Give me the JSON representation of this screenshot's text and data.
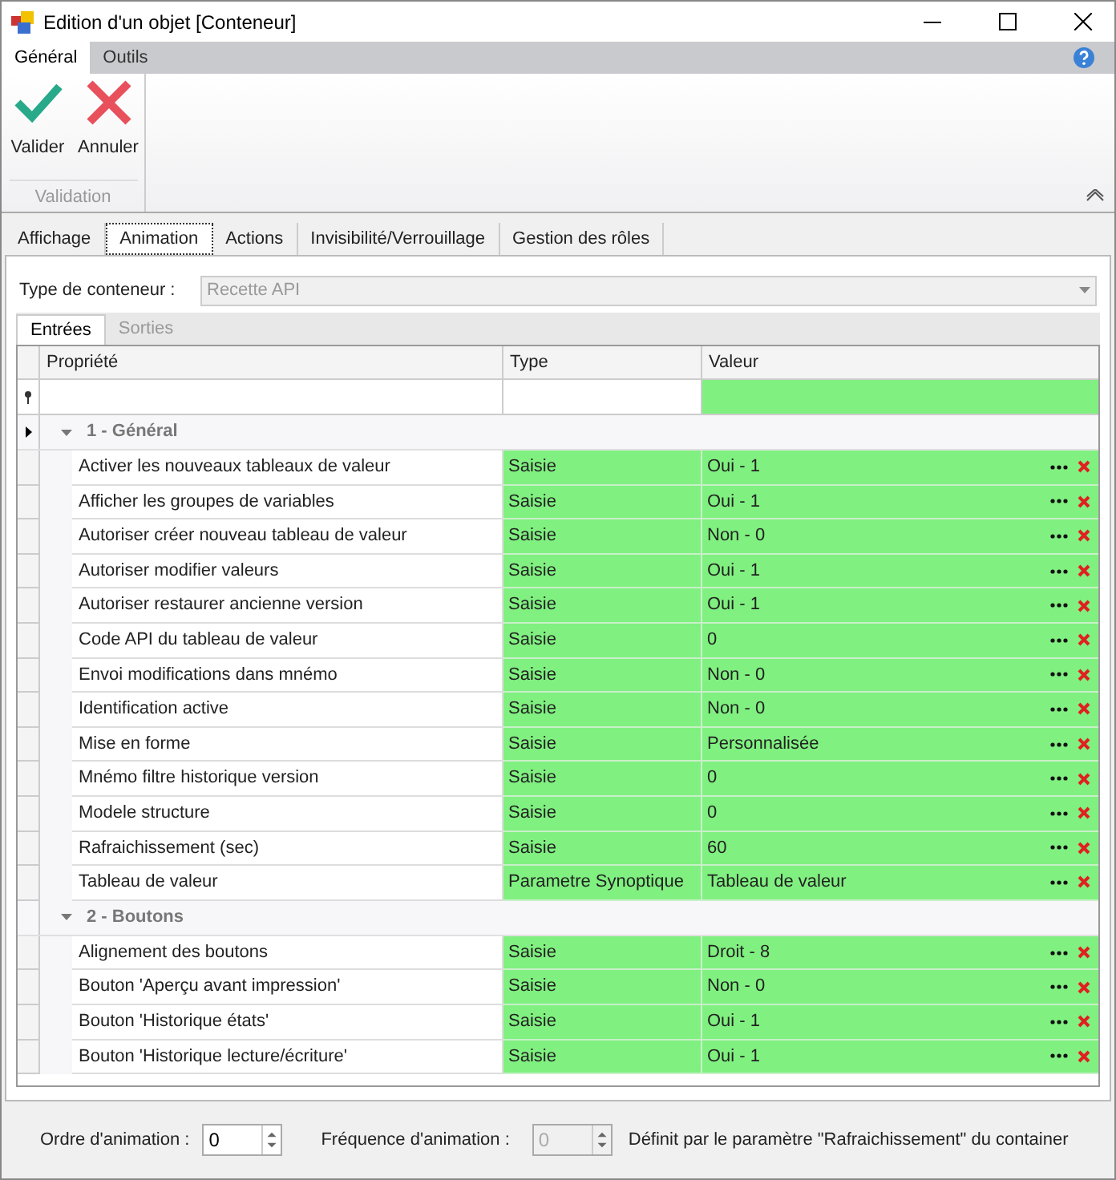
{
  "window": {
    "title": "Edition d'un objet [Conteneur]"
  },
  "ribbon_tabs": [
    {
      "label": "Général",
      "selected": true
    },
    {
      "label": "Outils",
      "selected": false
    }
  ],
  "ribbon_buttons": [
    {
      "kind": "ok",
      "label": "Valider"
    },
    {
      "kind": "cancel",
      "label": "Annuler"
    }
  ],
  "ribbon_group": "Validation",
  "tabs": [
    {
      "label": "Affichage",
      "selected": false
    },
    {
      "label": "Animation",
      "selected": true
    },
    {
      "label": "Actions",
      "selected": false
    },
    {
      "label": "Invisibilité/Verrouillage",
      "selected": false
    },
    {
      "label": "Gestion des rôles",
      "selected": false
    }
  ],
  "container_type": {
    "label": "Type de conteneur :",
    "value": "Recette API",
    "disabled": true
  },
  "sub_tabs": [
    {
      "label": "Entrées",
      "selected": true
    },
    {
      "label": "Sorties",
      "selected": false
    }
  ],
  "grid": {
    "columns": [
      "Propriété",
      "Type",
      "Valeur"
    ],
    "groups": [
      {
        "title": "1 - Général",
        "expanded": true,
        "selected": true,
        "rows": [
          {
            "property": "Activer les nouveaux tableaux de valeur",
            "type": "Saisie",
            "value": "Oui - 1"
          },
          {
            "property": "Afficher les groupes de variables",
            "type": "Saisie",
            "value": "Oui - 1"
          },
          {
            "property": "Autoriser créer nouveau tableau de valeur",
            "type": "Saisie",
            "value": "Non - 0"
          },
          {
            "property": "Autoriser modifier valeurs",
            "type": "Saisie",
            "value": "Oui - 1"
          },
          {
            "property": "Autoriser restaurer ancienne version",
            "type": "Saisie",
            "value": "Oui - 1"
          },
          {
            "property": "Code API du tableau de valeur",
            "type": "Saisie",
            "value": "0"
          },
          {
            "property": "Envoi modifications dans mnémo",
            "type": "Saisie",
            "value": "Non - 0"
          },
          {
            "property": "Identification active",
            "type": "Saisie",
            "value": "Non - 0"
          },
          {
            "property": "Mise en forme",
            "type": "Saisie",
            "value": "Personnalisée"
          },
          {
            "property": "Mnémo filtre historique version",
            "type": "Saisie",
            "value": "0"
          },
          {
            "property": "Modele structure",
            "type": "Saisie",
            "value": "0"
          },
          {
            "property": "Rafraichissement (sec)",
            "type": "Saisie",
            "value": "60"
          },
          {
            "property": "Tableau de valeur",
            "type": "Parametre Synoptique",
            "value": "Tableau de valeur"
          }
        ]
      },
      {
        "title": "2 - Boutons",
        "expanded": true,
        "selected": false,
        "rows": [
          {
            "property": "Alignement des boutons",
            "type": "Saisie",
            "value": "Droit - 8"
          },
          {
            "property": "Bouton 'Aperçu avant impression'",
            "type": "Saisie",
            "value": "Non - 0"
          },
          {
            "property": "Bouton 'Historique états'",
            "type": "Saisie",
            "value": "Oui - 1"
          },
          {
            "property": "Bouton 'Historique lecture/écriture'",
            "type": "Saisie",
            "value": "Oui - 1"
          }
        ]
      }
    ]
  },
  "footer": {
    "order_label": "Ordre d'animation :",
    "order_value": "0",
    "order_disabled": false,
    "freq_label": "Fréquence d'animation :",
    "freq_value": "0",
    "freq_disabled": true,
    "note": "Définit par le paramètre \"Rafraichissement\" du container"
  }
}
